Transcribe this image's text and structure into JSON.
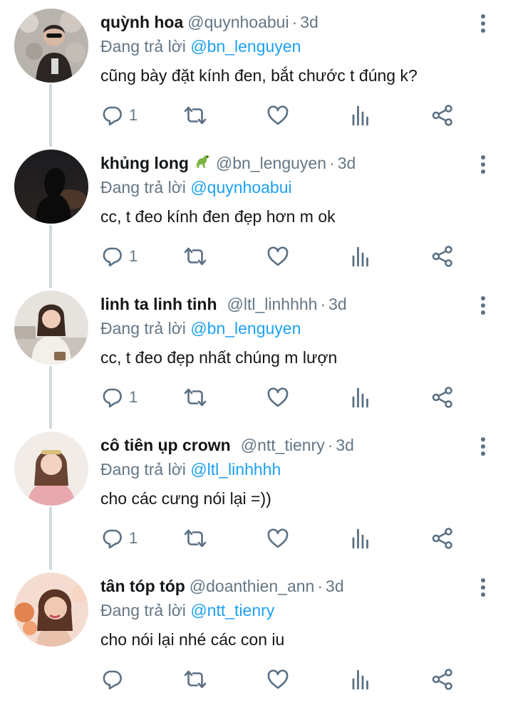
{
  "icons": {
    "reply": "reply-icon",
    "retweet": "retweet-icon",
    "like": "heart-icon",
    "analytics": "analytics-icon",
    "share": "share-icon",
    "more": "more-options-icon"
  },
  "colors": {
    "accent": "#1da1f2",
    "muted": "#657786",
    "text": "#14171a",
    "thread_line": "#cfd9de"
  },
  "tweets": [
    {
      "name": "quỳnh hoa",
      "handle": "@quynhoabui",
      "separator": "·",
      "time": "3d",
      "replying_prefix": "Đang trả lời",
      "replying_to": "@bn_lenguyen",
      "text": "cũng bày đặt kính đen, bắt chước t đúng k?",
      "reply_count": "1"
    },
    {
      "name": "khủng long",
      "emoji": "dinosaur",
      "handle": "@bn_lenguyen",
      "separator": "·",
      "time": "3d",
      "replying_prefix": "Đang trả lời",
      "replying_to": "@quynhoabui",
      "text": "cc, t đeo kính đen đẹp hơn m ok",
      "reply_count": "1"
    },
    {
      "name": "linh ta linh tinh",
      "handle": "@ltl_linhhhh",
      "separator": "·",
      "time": "3d",
      "replying_prefix": "Đang trả lời",
      "replying_to": "@bn_lenguyen",
      "text": "cc, t đeo đẹp nhất chúng m lượn",
      "reply_count": "1"
    },
    {
      "name": "cô tiên ụp crown",
      "handle": "@ntt_tienry",
      "separator": "·",
      "time": "3d",
      "replying_prefix": "Đang trả lời",
      "replying_to": "@ltl_linhhhh",
      "text": "cho các cưng nói lại =))",
      "reply_count": "1"
    },
    {
      "name": "tân tóp tóp",
      "handle": "@doanthien_ann",
      "separator": "·",
      "time": "3d",
      "replying_prefix": "Đang trả lời",
      "replying_to": "@ntt_tienry",
      "text": "cho nói lại nhé các con iu",
      "reply_count": ""
    }
  ]
}
